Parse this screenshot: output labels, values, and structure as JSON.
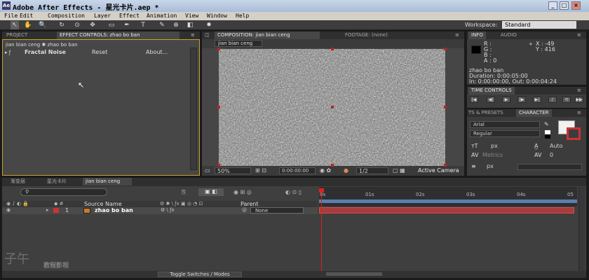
{
  "app": {
    "title": "Adobe After Effects - 星光卡片.aep *",
    "icon_label": "Ae",
    "window_buttons": {
      "minimize": "_",
      "restore": "□",
      "close": "×"
    }
  },
  "menu": [
    "File",
    "Edit",
    "Composition",
    "Layer",
    "Effect",
    "Animation",
    "View",
    "Window",
    "Help"
  ],
  "toolbar": {
    "tools": [
      "selection-tool-icon",
      "hand-tool-icon",
      "zoom-tool-icon",
      "rotate-tool-icon",
      "orbit-camera-icon",
      "pan-behind-icon",
      "rectangle-tool-icon",
      "pen-tool-icon",
      "type-tool-icon",
      "brush-tool-icon",
      "clone-stamp-icon",
      "eraser-icon",
      "puppet-pin-icon"
    ],
    "tool_glyphs": [
      "↖",
      "✋",
      "🔍",
      "↻",
      "⊙",
      "✥",
      "▭",
      "✒",
      "T",
      "✎",
      "⊕",
      "◧",
      "✸"
    ],
    "workspace_label": "Workspace:",
    "workspace_value": "Standard"
  },
  "left_panel": {
    "tabs": [
      "PROJECT",
      "EFFECT CONTROLS: zhao bo ban"
    ],
    "breadcrumb": "jian bian ceng ✱ zhao bo ban",
    "effect": {
      "name": "Fractal Noise",
      "reset": "Reset",
      "about": "About..."
    }
  },
  "comp_panel": {
    "tabs": [
      "COMPOSITION: jian bian ceng",
      "FOOTAGE: (none)"
    ],
    "subtab": "jian bian ceng",
    "footer": {
      "zoom": "50%",
      "timecode": "0:00:00:00",
      "resolution": "1/2",
      "camera": "Active Camera"
    }
  },
  "info_panel": {
    "tabs": [
      "INFO",
      "AUDIO"
    ],
    "rgba": [
      "R :",
      "G :",
      "B :",
      "A : 0"
    ],
    "x": "X : -49",
    "y": "Y : 416",
    "layer": "zhao bo ban",
    "duration": "Duration: 0:00:05:00",
    "inout": "In: 0:00:00:00, Out: 0:00:04:24"
  },
  "time_controls": {
    "tab": "TIME CONTROLS"
  },
  "character_panel": {
    "tabs": [
      "TS & PRESETS",
      "CHARACTER"
    ],
    "font": "Arial",
    "style": "Regular",
    "size_unit": "px",
    "leading": "Auto",
    "metrics": "Metrics",
    "tracking": "0",
    "stroke_unit": "px"
  },
  "timeline": {
    "tabs": [
      "渐变层",
      "星光卡片",
      "jian bian ceng"
    ],
    "search_placeholder": "",
    "columns": {
      "source": "Source Name",
      "parent": "Parent"
    },
    "layer": {
      "index": "1",
      "name": "zhao bo ban",
      "parent": "None"
    },
    "ruler": [
      "0s",
      "01s",
      "02s",
      "03s",
      "04s",
      "05"
    ],
    "toggle_label": "Toggle Switches / Modes"
  },
  "watermark": {
    "brand": "子午",
    "text": "教程影视"
  },
  "colors": {
    "accent_orange": "#c9a22a",
    "layer_bar": "#a83b3b",
    "playhead": "#c22222"
  }
}
